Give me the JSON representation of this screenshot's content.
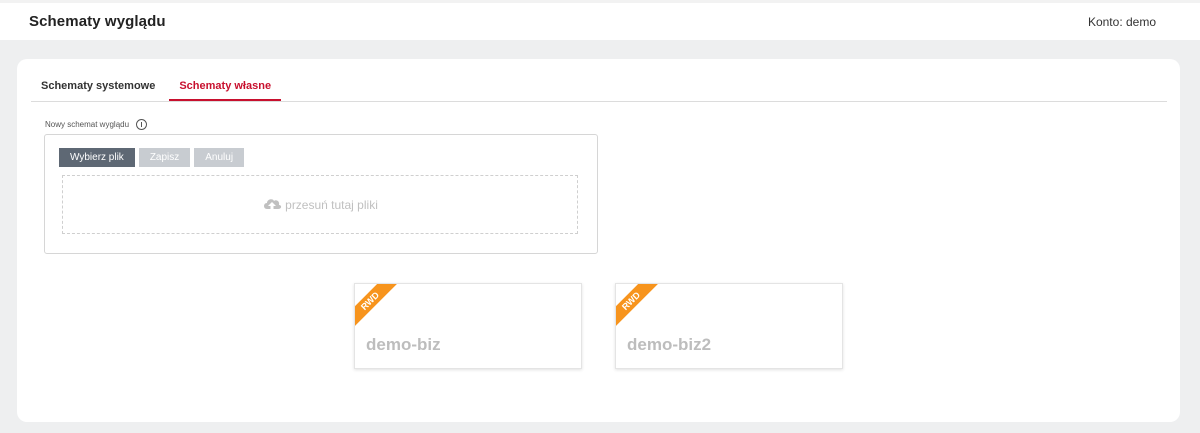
{
  "header": {
    "title": "Schematy wyglądu",
    "account": "Konto: demo"
  },
  "tabs": [
    {
      "label": "Schematy systemowe",
      "active": false
    },
    {
      "label": "Schematy własne",
      "active": true
    }
  ],
  "upload": {
    "label": "Nowy schemat wyglądu",
    "choose_label": "Wybierz plik",
    "save_label": "Zapisz",
    "cancel_label": "Anuluj",
    "dropzone_text": "przesuń tutaj pliki"
  },
  "themes": [
    {
      "name": "demo-biz",
      "badge": "RWD"
    },
    {
      "name": "demo-biz2",
      "badge": "RWD"
    }
  ],
  "colors": {
    "accent": "#c8102e",
    "badge": "#f7941d",
    "primary_button": "#5e6874",
    "disabled_button": "#c8ccd1"
  },
  "icons": [
    "info-icon",
    "cloud-upload-icon"
  ]
}
